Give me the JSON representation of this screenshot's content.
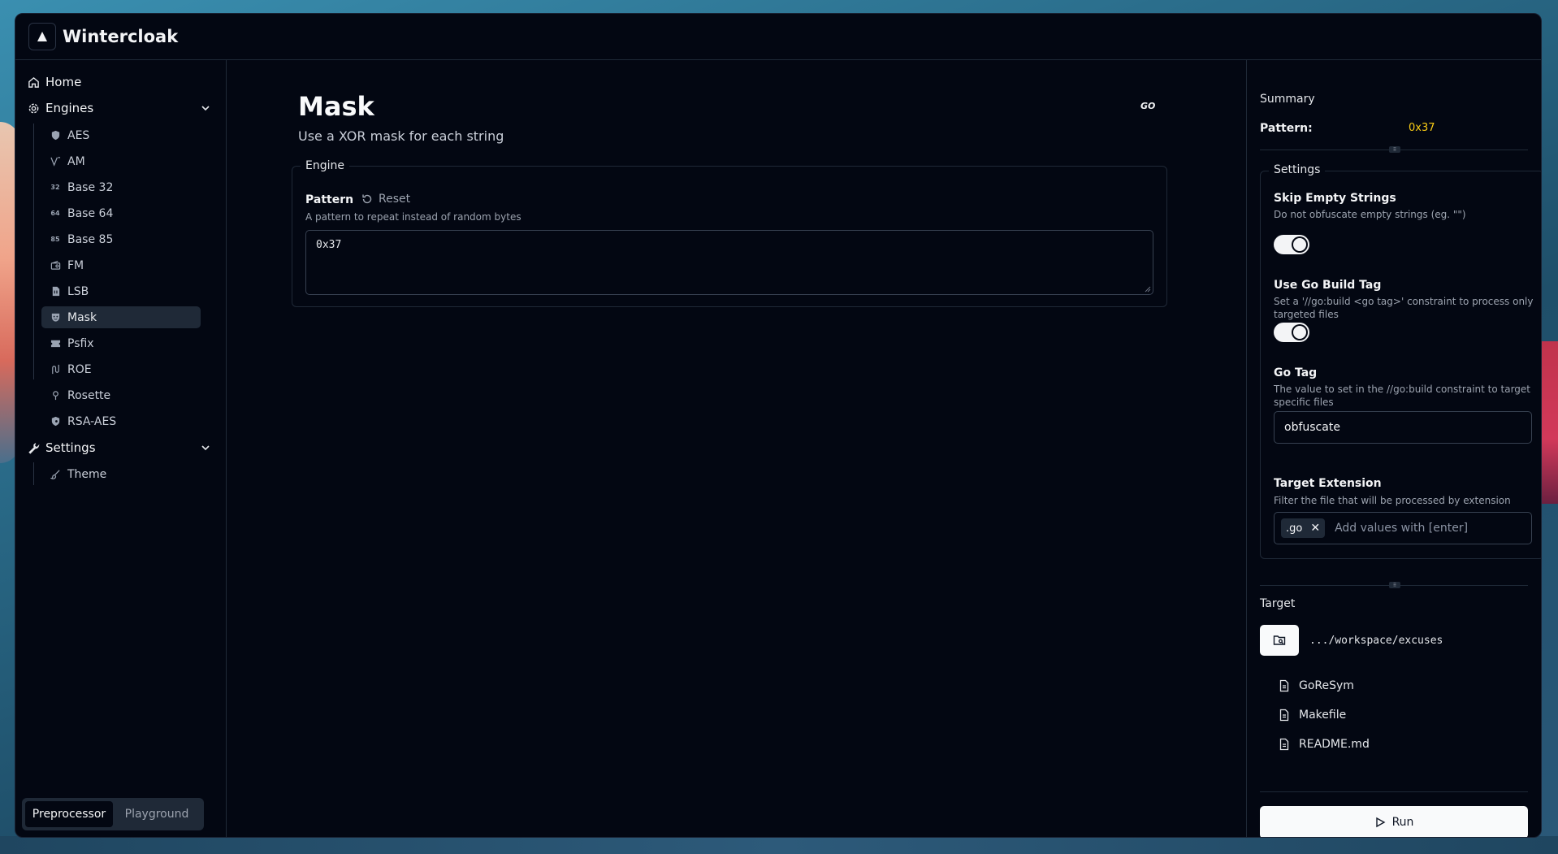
{
  "app": {
    "title": "Wintercloak"
  },
  "sidebar": {
    "home": "Home",
    "engines_label": "Engines",
    "engines": [
      {
        "label": "AES",
        "icon": "shield-icon"
      },
      {
        "label": "AM",
        "icon": "signal-icon"
      },
      {
        "label": "Base 32",
        "icon": "32"
      },
      {
        "label": "Base 64",
        "icon": "64"
      },
      {
        "label": "Base 85",
        "icon": "85"
      },
      {
        "label": "FM",
        "icon": "radio-icon"
      },
      {
        "label": "LSB",
        "icon": "file-binary-icon"
      },
      {
        "label": "Mask",
        "icon": "mask-icon"
      },
      {
        "label": "Psfix",
        "icon": "ticket-icon"
      },
      {
        "label": "ROE",
        "icon": "route-icon"
      },
      {
        "label": "Rosette",
        "icon": "pin-icon"
      },
      {
        "label": "RSA-AES",
        "icon": "key-shield-icon"
      }
    ],
    "settings_label": "Settings",
    "settings_items": [
      {
        "label": "Theme",
        "icon": "brush-icon"
      }
    ],
    "modes": {
      "preprocessor": "Preprocessor",
      "playground": "Playground",
      "active": "Preprocessor"
    }
  },
  "main": {
    "title": "Mask",
    "subtitle": "Use a XOR mask for each string",
    "badge": "GO",
    "engine_legend": "Engine",
    "pattern_label": "Pattern",
    "reset_label": "Reset",
    "pattern_desc": "A pattern to repeat instead of random bytes",
    "pattern_value": "0x37"
  },
  "right": {
    "summary_label": "Summary",
    "pattern_key": "Pattern:",
    "pattern_value": "0x37",
    "settings_legend": "Settings",
    "skip_empty": {
      "label": "Skip Empty Strings",
      "desc": "Do not obfuscate empty strings (eg. \"\")",
      "on": true
    },
    "use_build_tag": {
      "label": "Use Go Build Tag",
      "desc": "Set a '//go:build <go tag>' constraint to process only targeted files",
      "on": true
    },
    "go_tag": {
      "label": "Go Tag",
      "desc": "The value to set in the //go:build constraint to target specific files",
      "value": "obfuscate"
    },
    "target_ext": {
      "label": "Target Extension",
      "desc": "Filter the file that will be processed by extension",
      "chips": [
        ".go"
      ],
      "placeholder": "Add values with [enter]"
    },
    "target_label": "Target",
    "target_path": ".../workspace/excuses",
    "files": [
      "GoReSym",
      "Makefile",
      "README.md"
    ],
    "run_label": "Run"
  },
  "colors": {
    "accent_yellow": "#facc15",
    "bg": "#030712",
    "border": "#1f2937"
  }
}
